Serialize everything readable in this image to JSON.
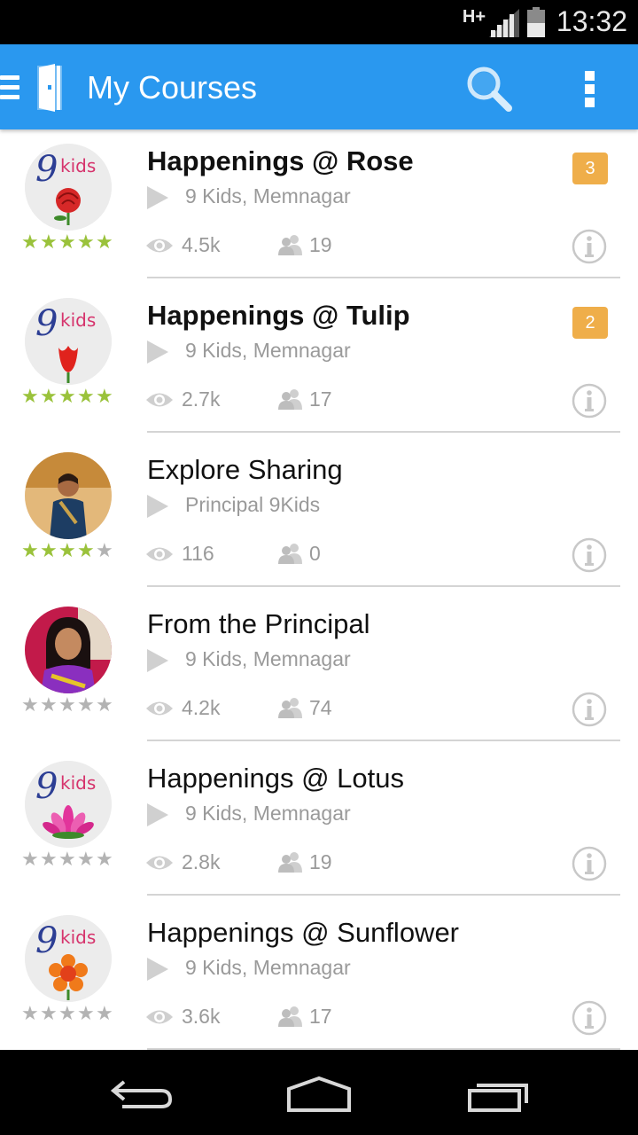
{
  "status_bar": {
    "network": "H+",
    "time": "13:32"
  },
  "app_bar": {
    "title": "My Courses"
  },
  "courses": [
    {
      "title": "Happenings @ Rose",
      "bold": true,
      "subtitle": "9 Kids, Memnagar",
      "views": "4.5k",
      "members": "19",
      "badge": "3",
      "rating": 5,
      "thumb": "9kids-rose-logo"
    },
    {
      "title": "Happenings @ Tulip",
      "bold": true,
      "subtitle": "9 Kids, Memnagar",
      "views": "2.7k",
      "members": "17",
      "badge": "2",
      "rating": 5,
      "thumb": "9kids-tulip-logo"
    },
    {
      "title": "Explore Sharing",
      "bold": false,
      "subtitle": "Principal 9Kids",
      "views": "116",
      "members": "0",
      "badge": null,
      "rating": 4,
      "thumb": "principal-photo"
    },
    {
      "title": "From the Principal",
      "bold": false,
      "subtitle": "9 Kids, Memnagar",
      "views": "4.2k",
      "members": "74",
      "badge": null,
      "rating": 0,
      "thumb": "principal-photo-2"
    },
    {
      "title": "Happenings @ Lotus",
      "bold": false,
      "subtitle": "9 Kids, Memnagar",
      "views": "2.8k",
      "members": "19",
      "badge": null,
      "rating": 0,
      "thumb": "9kids-lotus-logo"
    },
    {
      "title": "Happenings @ Sunflower",
      "bold": false,
      "subtitle": "9 Kids, Memnagar",
      "views": "3.6k",
      "members": "17",
      "badge": null,
      "rating": 0,
      "thumb": "9kids-sunflower-logo"
    }
  ],
  "logo_text": {
    "nine": "9",
    "kids": "kids"
  },
  "colors": {
    "app_bar": "#2a98ef",
    "badge": "#efae4a",
    "star_on": "#9ac23b",
    "star_off": "#b3b3b3"
  }
}
